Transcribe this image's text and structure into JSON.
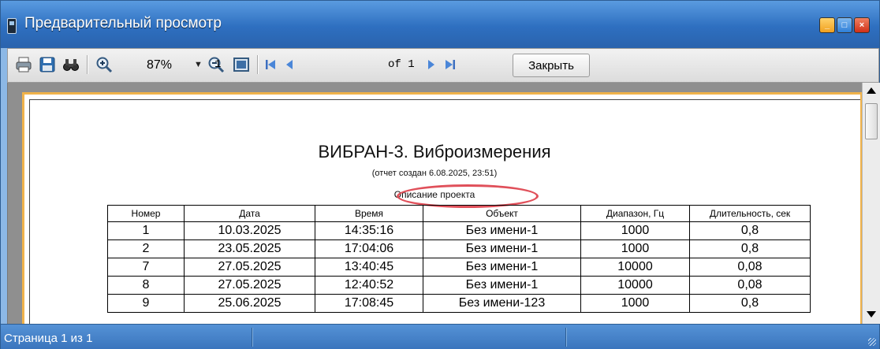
{
  "window": {
    "title": "Предварительный просмотр"
  },
  "toolbar": {
    "zoom": "87%",
    "page_current": "1",
    "page_of": "of 1",
    "close_label": "Закрыть"
  },
  "report": {
    "title": "ВИБРАН-3. Виброизмерения",
    "subtitle": "(отчет создан 6.08.2025, 23:51)",
    "description": "Описание проекта",
    "columns": [
      "Номер",
      "Дата",
      "Время",
      "Объект",
      "Диапазон, Гц",
      "Длительность, сек"
    ],
    "rows": [
      [
        "1",
        "10.03.2025",
        "14:35:16",
        "Без имени-1",
        "1000",
        "0,8"
      ],
      [
        "2",
        "23.05.2025",
        "17:04:06",
        "Без имени-1",
        "1000",
        "0,8"
      ],
      [
        "7",
        "27.05.2025",
        "13:40:45",
        "Без имени-1",
        "10000",
        "0,08"
      ],
      [
        "8",
        "27.05.2025",
        "12:40:52",
        "Без имени-1",
        "10000",
        "0,08"
      ],
      [
        "9",
        "25.06.2025",
        "17:08:45",
        "Без имени-123",
        "1000",
        "0,8"
      ]
    ]
  },
  "status": {
    "text": "Страница 1 из 1"
  },
  "colors": {
    "titlebar": "#2e6fc0",
    "page_border": "#f0b24a",
    "highlight_circle": "#e0505a",
    "viewport_bg": "#8f8f8f"
  },
  "icons": [
    "print-icon",
    "save-icon",
    "find-icon",
    "zoom-in-icon",
    "zoom-out-icon",
    "page-view-icon",
    "first-page-icon",
    "prev-page-icon",
    "next-page-icon",
    "last-page-icon"
  ]
}
